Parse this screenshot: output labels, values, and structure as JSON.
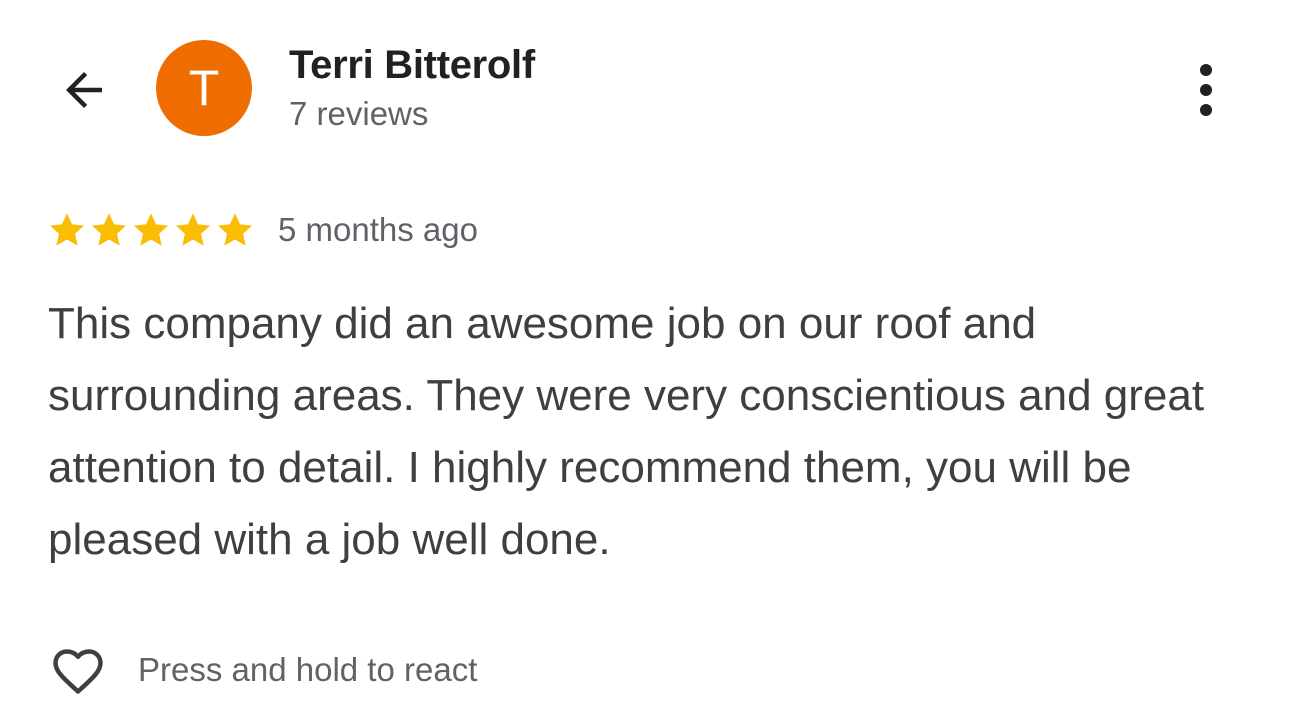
{
  "header": {
    "back_icon": "arrow-back-icon",
    "avatar_letter": "T",
    "avatar_color": "#ef6c00",
    "author_name": "Terri Bitterolf",
    "author_reviews": "7 reviews",
    "more_icon": "more-vertical-icon"
  },
  "review": {
    "rating": 5,
    "rating_max": 5,
    "star_color": "#fbbc04",
    "time_ago": "5 months ago",
    "text": "This company did an awesome job on our roof and surrounding areas. They were very conscientious and great attention to detail. I highly recommend them, you will be pleased with a job well done."
  },
  "reactions": {
    "heart_icon": "heart-outline-icon",
    "label": "Press and hold to react"
  }
}
